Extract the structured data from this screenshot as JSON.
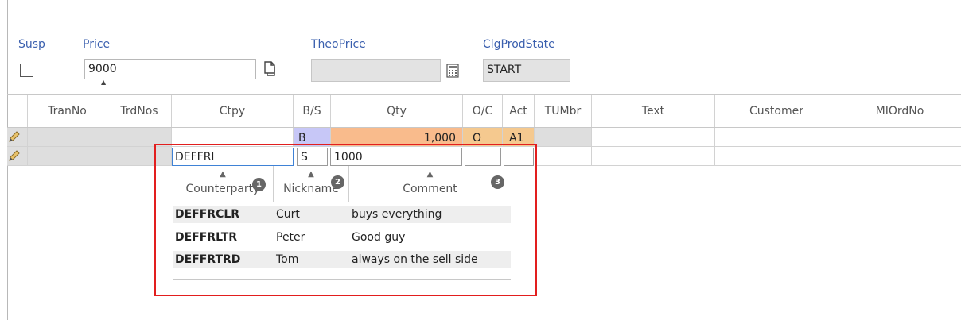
{
  "form": {
    "susp_label": "Susp",
    "price_label": "Price",
    "price_value": "9000",
    "theo_price_label": "TheoPrice",
    "theo_price_value": "",
    "clg_prod_state_label": "ClgProdState",
    "clg_prod_state_value": "START"
  },
  "grid": {
    "columns": [
      "TranNo",
      "TrdNos",
      "Ctpy",
      "B/S",
      "Qty",
      "O/C",
      "Act",
      "TUMbr",
      "Text",
      "Customer",
      "MIOrdNo"
    ],
    "row1": {
      "bs": "B",
      "qty": "1,000",
      "oc": "O",
      "act": "A1"
    },
    "row2": {
      "ctpy": "DEFFRl",
      "bs": "S",
      "qty": "1000"
    }
  },
  "dropdown": {
    "headers": [
      "Counterparty",
      "Nickname",
      "Comment"
    ],
    "badges": [
      "1",
      "2",
      "3"
    ],
    "rows": [
      {
        "counterparty": "DEFFRCLR",
        "nickname": "Curt",
        "comment": "buys everything"
      },
      {
        "counterparty": "DEFFRLTR",
        "nickname": "Peter",
        "comment": "Good guy"
      },
      {
        "counterparty": "DEFFRTRD",
        "nickname": "Tom",
        "comment": "always on the sell side"
      }
    ]
  },
  "colors": {
    "label_blue": "#3a5fae",
    "buy_cell": "#c7c7f7",
    "qty_cell": "#f9bb8c",
    "oc_cell": "#f5c98f",
    "highlight_border": "#e21e1e"
  }
}
